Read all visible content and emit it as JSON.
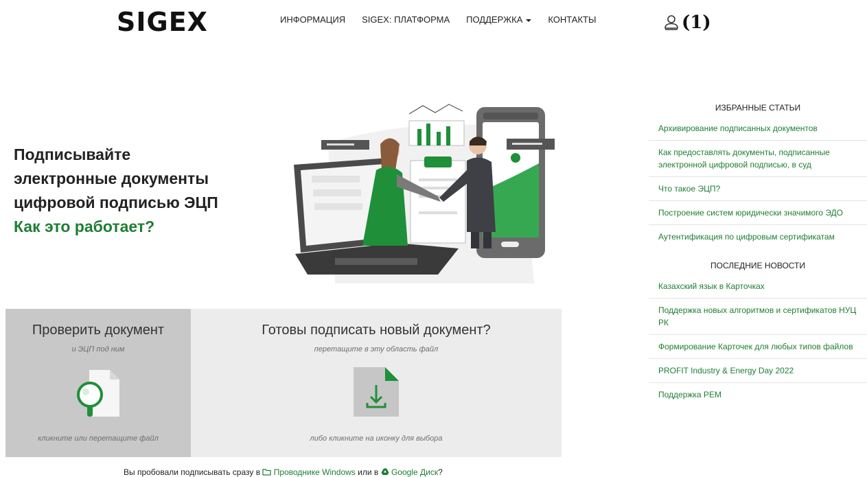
{
  "header": {
    "logo": "SIGEX",
    "nav": [
      "ИНФОРМАЦИЯ",
      "SIGEX: ПЛАТФОРМА",
      "ПОДДЕРЖКА",
      "КОНТАКТЫ"
    ],
    "user_count": "(1)",
    "user_icon": "user-icon"
  },
  "hero": {
    "lines": [
      "Подписывайте",
      "электронные документы",
      "цифровой подписью ЭЦП"
    ],
    "link": "Как это работает?"
  },
  "check_panel": {
    "title": "Проверить документ",
    "subtitle": "и ЭЦП под ним",
    "footer": "кликните или перетащите файл",
    "icon": "magnifier-document-icon"
  },
  "sign_panel": {
    "title": "Готовы подписать новый документ?",
    "subtitle": "перетащите в эту область файл",
    "footer": "либо кликните на иконку для выбора",
    "icon": "download-document-icon"
  },
  "footnote": {
    "prefix": "Вы пробовали подписывать сразу в",
    "link1": "Проводнике Windows",
    "middle": "или в",
    "link2": "Google Диск",
    "suffix": "?"
  },
  "sidebar": {
    "featured_title": "ИЗБРАННЫЕ СТАТЬИ",
    "featured": [
      "Архивирование подписанных документов",
      "Как предоставлять документы, подписанные электронной цифровой подписью, в суд",
      "Что такое ЭЦП?",
      "Построение систем юридически значимого ЭДО",
      "Аутентификация по цифровым сертификатам"
    ],
    "news_title": "ПОСЛЕДНИЕ НОВОСТИ",
    "news": [
      "Казахский язык в Карточках",
      "Поддержка новых алгоритмов и сертификатов НУЦ РК",
      "Формирование Карточек для любых типов файлов",
      "PROFIT Industry & Energy Day 2022",
      "Поддержка PEM"
    ]
  },
  "colors": {
    "accent": "#1e7e34",
    "panel_dark": "#c8c8c8",
    "panel_light": "#ececec"
  }
}
